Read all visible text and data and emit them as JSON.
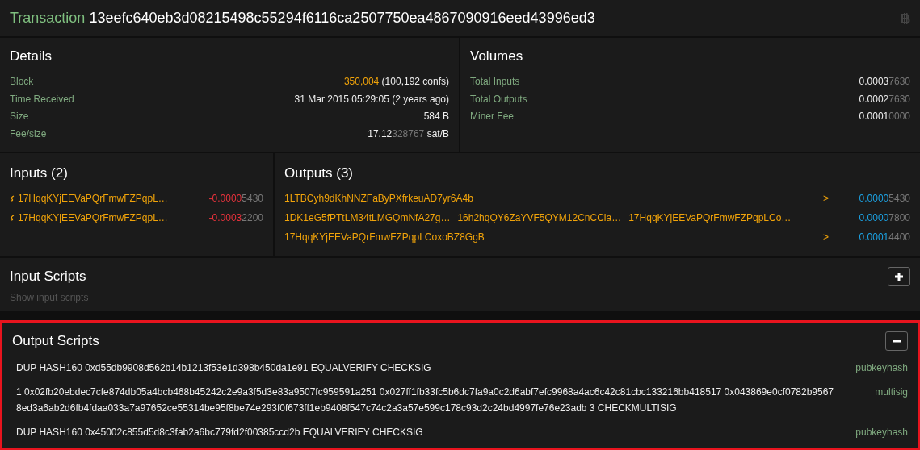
{
  "header": {
    "label": "Transaction",
    "txid": "13eefc640eb3d08215498c55294f6116ca2507750ea4867090916eed43996ed3"
  },
  "details": {
    "title": "Details",
    "rows": [
      {
        "label": "Block",
        "kind": "block",
        "link": "350,004",
        "value": "(100,192 confs)"
      },
      {
        "label": "Time Received",
        "kind": "plain",
        "value": "31 Mar 2015 05:29:05 (2 years ago)"
      },
      {
        "label": "Size",
        "kind": "plain",
        "value": "584 B"
      },
      {
        "label": "Fee/size",
        "kind": "split",
        "main": "17.12",
        "dim": "328767",
        "unit": "sat/B"
      }
    ]
  },
  "volumes": {
    "title": "Volumes",
    "rows": [
      {
        "label": "Total Inputs",
        "main": "0.0003",
        "dim": "7630"
      },
      {
        "label": "Total Outputs",
        "main": "0.0002",
        "dim": "7630"
      },
      {
        "label": "Miner Fee",
        "main": "0.0001",
        "dim": "0000"
      }
    ]
  },
  "inputs": {
    "title": "Inputs (2)",
    "rows": [
      {
        "address": "17HqqKYjEEVaPQrFmwFZPqpL…",
        "main": "-0.0000",
        "dim": "5430"
      },
      {
        "address": "17HqqKYjEEVaPQrFmwFZPqpL…",
        "main": "-0.0003",
        "dim": "2200"
      }
    ]
  },
  "outputs": {
    "title": "Outputs (3)",
    "rows": [
      {
        "addresses": [
          "1LTBCyh9dKhNNZFaByPXfrkeuAD7yr6A4b"
        ],
        "arrow": ">",
        "main": "0.0000",
        "dim": "5430"
      },
      {
        "addresses": [
          "1DK1eG5fPTtLM34tLMGQmNfA27g…",
          "16h2hqQY6ZaYVF5QYM12CnCCia…",
          "17HqqKYjEEVaPQrFmwFZPqpLCo…"
        ],
        "main": "0.0000",
        "dim": "7800"
      },
      {
        "addresses": [
          "17HqqKYjEEVaPQrFmwFZPqpLCoxoBZ8GgB"
        ],
        "arrow": ">",
        "main": "0.0001",
        "dim": "4400"
      }
    ]
  },
  "input_scripts": {
    "title": "Input Scripts",
    "expanded": false,
    "hint": "Show input scripts",
    "highlighted": false
  },
  "output_scripts": {
    "title": "Output Scripts",
    "expanded": true,
    "highlighted": true,
    "rows": [
      {
        "script": "DUP HASH160 0xd55db9908d562b14b1213f53e1d398b450da1e91 EQUALVERIFY CHECKSIG",
        "type": "pubkeyhash"
      },
      {
        "script": "1 0x02fb20ebdec7cfe874db05a4bcb468b45242c2e9a3f5d3e83a9507fc959591a251 0x027ff1fb33fc5b6dc7fa9a0c2d6abf7efc9968a4ac6c42c81cbc133216bb418517 0x043869e0cf0782b95678ed3a6ab2d6fb4fdaa033a7a97652ce55314be95f8be74e293f0f673ff1eb9408f547c74c2a3a57e599c178c93d2c24bd4997fe76e23adb 3 CHECKMULTISIG",
        "type": "multisig"
      },
      {
        "script": "DUP HASH160 0x45002c855d5d8c3fab2a6bc779fd2f00385ccd2b EQUALVERIFY CHECKSIG",
        "type": "pubkeyhash"
      }
    ]
  }
}
